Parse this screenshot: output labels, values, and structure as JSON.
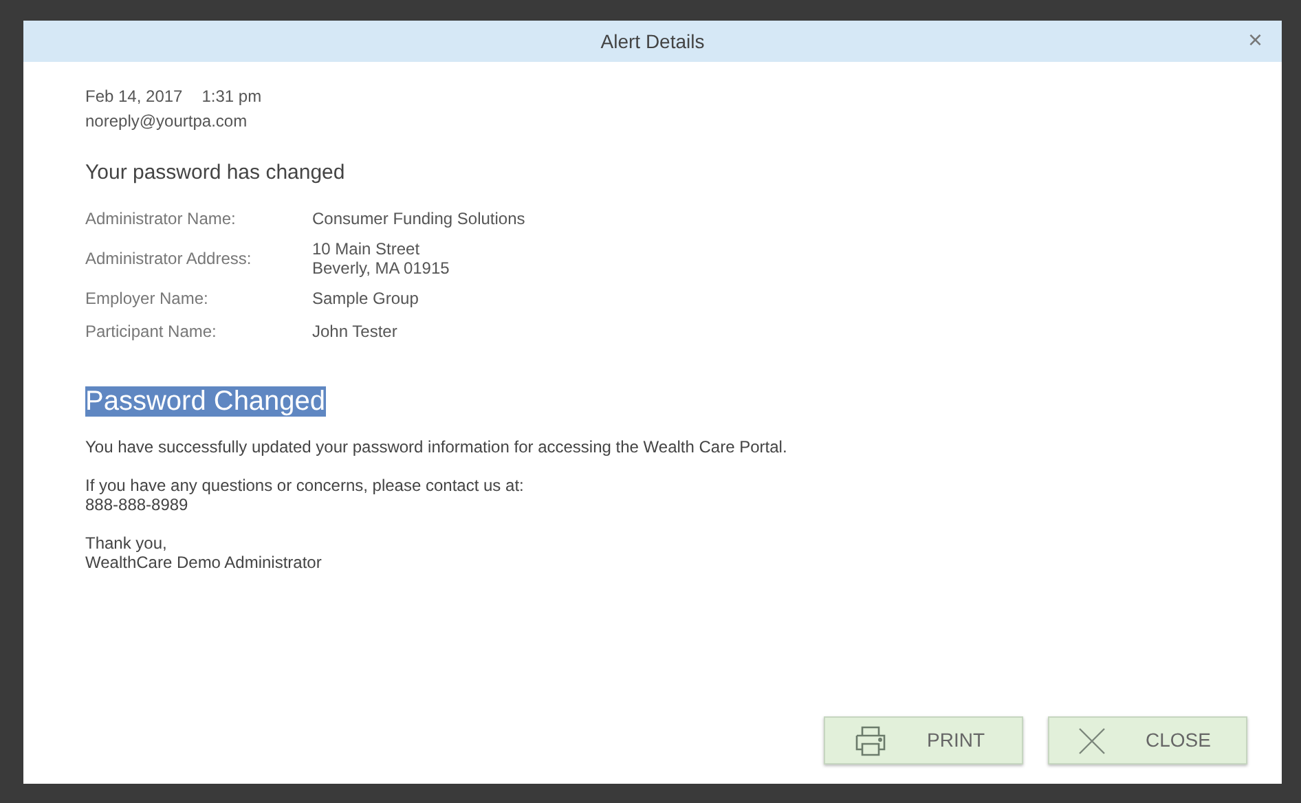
{
  "dialog": {
    "title": "Alert Details",
    "close_glyph": "×"
  },
  "message": {
    "date": "Feb 14, 2017",
    "time": "1:31 pm",
    "sender": "noreply@yourtpa.com",
    "subject": "Your password has changed"
  },
  "details": [
    {
      "label": "Administrator Name:",
      "value": [
        "Consumer Funding Solutions"
      ]
    },
    {
      "label": "Administrator Address:",
      "value": [
        "10 Main Street",
        "Beverly, MA 01915"
      ]
    },
    {
      "label": "Employer Name:",
      "value": [
        "Sample Group"
      ]
    },
    {
      "label": "Participant Name:",
      "value": [
        "John Tester"
      ]
    }
  ],
  "body": {
    "heading": "Password Changed",
    "heading_selected": true,
    "paragraphs": [
      [
        "You have successfully updated your password information for accessing the Wealth Care Portal."
      ],
      [
        "If you have any questions or concerns, please contact us at:",
        "888-888-8989"
      ],
      [
        "Thank you,",
        "WealthCare Demo Administrator"
      ]
    ]
  },
  "buttons": [
    {
      "kind": "print",
      "label": "PRINT"
    },
    {
      "kind": "close",
      "label": "CLOSE"
    }
  ]
}
